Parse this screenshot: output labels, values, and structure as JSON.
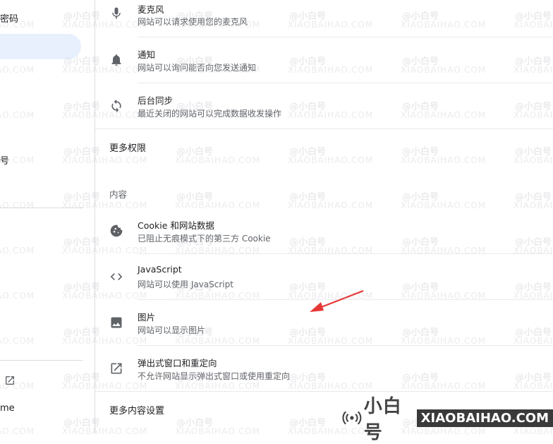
{
  "sidebar": {
    "item_passwords": "密码",
    "item_highlight": "",
    "item_partial": "号",
    "item_bottom": "me"
  },
  "permissions": {
    "microphone": {
      "title": "麦克风",
      "desc": "网站可以请求使用您的麦克风"
    },
    "notifications": {
      "title": "通知",
      "desc": "网站可以询问能否向您发送通知"
    },
    "background_sync": {
      "title": "后台同步",
      "desc": "最近关闭的网站可以完成数据收发操作"
    },
    "more_permissions": "更多权限"
  },
  "content": {
    "section_label": "内容",
    "cookies": {
      "title": "Cookie 和网站数据",
      "desc": "已阻止无痕模式下的第三方 Cookie"
    },
    "javascript": {
      "title": "JavaScript",
      "desc": "网站可以使用 JavaScript"
    },
    "images": {
      "title": "图片",
      "desc": "网站可以显示图片"
    },
    "popups": {
      "title": "弹出式窗口和重定向",
      "desc": "不允许网站显示弹出式窗口或使用重定向"
    },
    "more_content_settings": "更多内容设置"
  },
  "watermark": {
    "cn": "@小白号",
    "en": "XIAOBAIHAO.COM"
  },
  "brand": {
    "cn": "小白号",
    "en": "XIAOBAIHAO.COM"
  },
  "icons": {
    "microphone": "microphone-icon",
    "bell": "bell-icon",
    "sync": "sync-icon",
    "cookie": "cookie-icon",
    "code": "code-icon",
    "image": "image-icon",
    "popup": "open-in-new-icon",
    "chevron": "chevron-right-icon"
  },
  "colors": {
    "highlight": "#e8f0fe",
    "annotation_arrow": "#e53935"
  }
}
